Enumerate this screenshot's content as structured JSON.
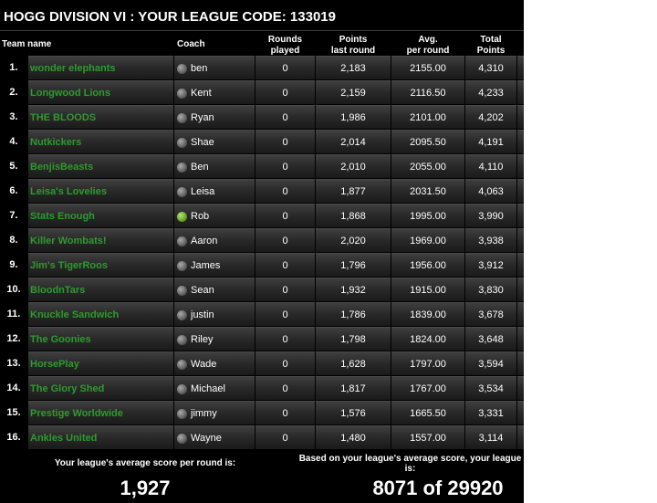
{
  "title": "HOGG DIVISION VI : YOUR LEAGUE CODE: 133019",
  "headers": {
    "team": "Team name",
    "coach": "Coach",
    "rounds1": "Rounds",
    "rounds2": "played",
    "points1": "Points",
    "points2": "last round",
    "avg1": "Avg.",
    "avg2": "per round",
    "total1": "Total",
    "total2": "Points"
  },
  "rows": [
    {
      "rank": "1.",
      "team": "wonder elephants",
      "coach": "ben",
      "rounds": "0",
      "points": "2,183",
      "avg": "2155.00",
      "total": "4,310",
      "active": false
    },
    {
      "rank": "2.",
      "team": "Longwood Lions",
      "coach": "Kent",
      "rounds": "0",
      "points": "2,159",
      "avg": "2116.50",
      "total": "4,233",
      "active": false
    },
    {
      "rank": "3.",
      "team": "THE BLOODS",
      "coach": "Ryan",
      "rounds": "0",
      "points": "1,986",
      "avg": "2101.00",
      "total": "4,202",
      "active": false
    },
    {
      "rank": "4.",
      "team": "Nutkickers",
      "coach": "Shae",
      "rounds": "0",
      "points": "2,014",
      "avg": "2095.50",
      "total": "4,191",
      "active": false
    },
    {
      "rank": "5.",
      "team": "BenjisBeasts",
      "coach": "Ben",
      "rounds": "0",
      "points": "2,010",
      "avg": "2055.00",
      "total": "4,110",
      "active": false
    },
    {
      "rank": "6.",
      "team": "Leisa's Lovelies",
      "coach": "Leisa",
      "rounds": "0",
      "points": "1,877",
      "avg": "2031.50",
      "total": "4,063",
      "active": false
    },
    {
      "rank": "7.",
      "team": "Stats Enough",
      "coach": "Rob",
      "rounds": "0",
      "points": "1,868",
      "avg": "1995.00",
      "total": "3,990",
      "active": true
    },
    {
      "rank": "8.",
      "team": "Killer Wombats!",
      "coach": "Aaron",
      "rounds": "0",
      "points": "2,020",
      "avg": "1969.00",
      "total": "3,938",
      "active": false
    },
    {
      "rank": "9.",
      "team": "Jim's TigerRoos",
      "coach": "James",
      "rounds": "0",
      "points": "1,796",
      "avg": "1956.00",
      "total": "3,912",
      "active": false
    },
    {
      "rank": "10.",
      "team": "BloodnTars",
      "coach": "Sean",
      "rounds": "0",
      "points": "1,932",
      "avg": "1915.00",
      "total": "3,830",
      "active": false
    },
    {
      "rank": "11.",
      "team": "Knuckle Sandwich",
      "coach": "justin",
      "rounds": "0",
      "points": "1,786",
      "avg": "1839.00",
      "total": "3,678",
      "active": false
    },
    {
      "rank": "12.",
      "team": "The Goonies",
      "coach": "Riley",
      "rounds": "0",
      "points": "1,798",
      "avg": "1824.00",
      "total": "3,648",
      "active": false
    },
    {
      "rank": "13.",
      "team": "HorsePlay",
      "coach": "Wade",
      "rounds": "0",
      "points": "1,628",
      "avg": "1797.00",
      "total": "3,594",
      "active": false
    },
    {
      "rank": "14.",
      "team": "The Glory Shed",
      "coach": "Michael",
      "rounds": "0",
      "points": "1,817",
      "avg": "1767.00",
      "total": "3,534",
      "active": false
    },
    {
      "rank": "15.",
      "team": "Prestige Worldwide",
      "coach": "jimmy",
      "rounds": "0",
      "points": "1,576",
      "avg": "1665.50",
      "total": "3,331",
      "active": false
    },
    {
      "rank": "16.",
      "team": "Ankles United",
      "coach": "Wayne",
      "rounds": "0",
      "points": "1,480",
      "avg": "1557.00",
      "total": "3,114",
      "active": false
    }
  ],
  "footer": {
    "avg_label": "Your league's average score per round is:",
    "avg_value": "1,927",
    "rank_label1": "Based on your league's average score, your league",
    "rank_label2": "is:",
    "rank_value": "8071 of 29920"
  },
  "colors": {
    "team_name": "#2e9b2e",
    "active_dot": "#5a9a1a",
    "inactive_dot": "#777777"
  },
  "icons": {
    "coach_status": "status-dot-icon"
  }
}
